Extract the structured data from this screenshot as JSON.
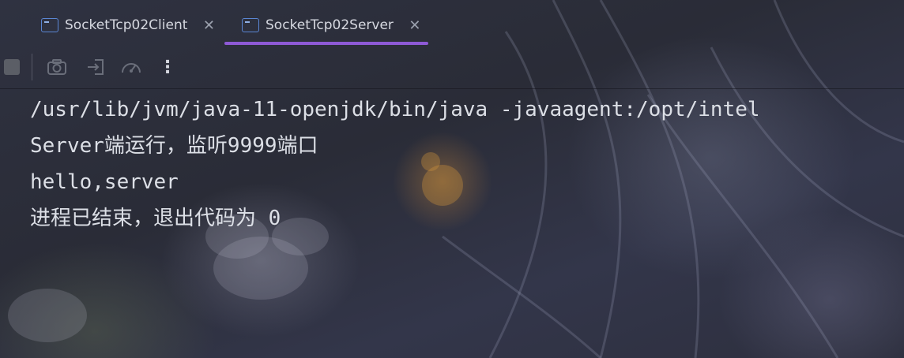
{
  "tabs": [
    {
      "label": "SocketTcp02Client",
      "icon": "window-icon",
      "active": false
    },
    {
      "label": "SocketTcp02Server",
      "icon": "window-icon",
      "active": true
    }
  ],
  "colors": {
    "active_tab_underline": "#8e5ad6",
    "console_text": "#dcdfe6",
    "tab_icon": "#5a86d4"
  },
  "toolbar": {
    "icons": [
      "stop-icon",
      "camera-icon",
      "login-icon",
      "gauge-icon",
      "more-vertical-icon"
    ]
  },
  "console": {
    "lines": [
      "/usr/lib/jvm/java-11-openjdk/bin/java -javaagent:/opt/intel",
      "Server端运行，监听9999端口",
      "hello,server",
      "进程已结束，退出代码为 0"
    ]
  }
}
